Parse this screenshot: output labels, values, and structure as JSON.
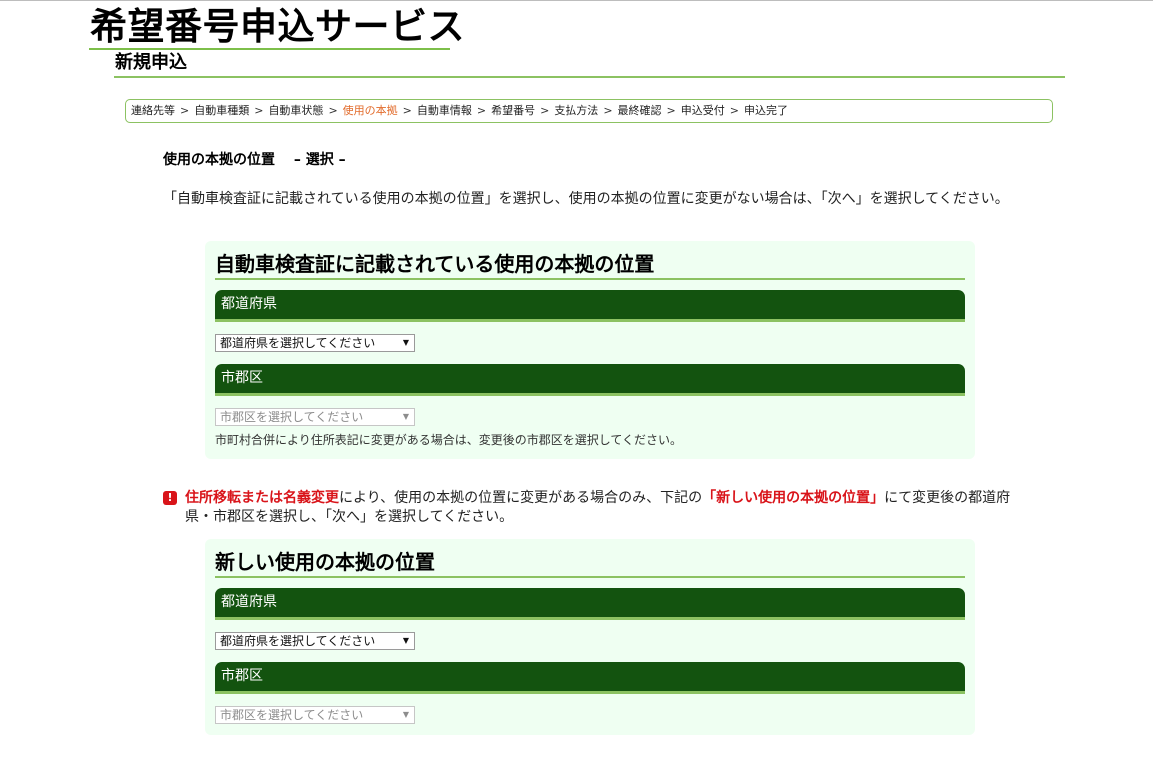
{
  "header": {
    "site_title": "希望番号申込サービス",
    "page_subtitle": "新規申込"
  },
  "breadcrumb": {
    "items": [
      "連絡先等",
      "自動車種類",
      "自動車状態",
      "使用の本拠",
      "自動車情報",
      "希望番号",
      "支払方法",
      "最終確認",
      "申込受付",
      "申込完了"
    ],
    "separator": ">",
    "current_index": 3
  },
  "main": {
    "heading": "使用の本拠の位置　 – 選択 –",
    "instruction": "「自動車検査証に記載されている使用の本拠の位置」を選択し、使用の本拠の位置に変更がない場合は、「次へ」を選択してください。"
  },
  "registered_location": {
    "title": "自動車検査証に記載されている使用の本拠の位置",
    "prefecture_label": "都道府県",
    "prefecture_select": "都道府県を選択してください",
    "city_label": "市郡区",
    "city_select": "市郡区を選択してください",
    "help": "市町村合併により住所表記に変更がある場合は、変更後の市郡区を選択してください。"
  },
  "notice": {
    "icon": "exclamation-icon",
    "emphasis1": "住所移転または名義変更",
    "text1": "により、使用の本拠の位置に変更がある場合のみ、下記の",
    "emphasis2": "「新しい使用の本拠の位置」",
    "text2": "にて変更後の都道府県・市郡区を選択し、「次へ」を選択してください。"
  },
  "new_location": {
    "title": "新しい使用の本拠の位置",
    "prefecture_label": "都道府県",
    "prefecture_select": "都道府県を選択してください",
    "city_label": "市郡区",
    "city_select": "市郡区を選択してください"
  },
  "colors": {
    "accent_line": "#8cc262",
    "field_header_bg": "#13530f",
    "panel_bg": "#effff2",
    "current_step": "#e26b2b",
    "warning_red": "#d9141a"
  }
}
